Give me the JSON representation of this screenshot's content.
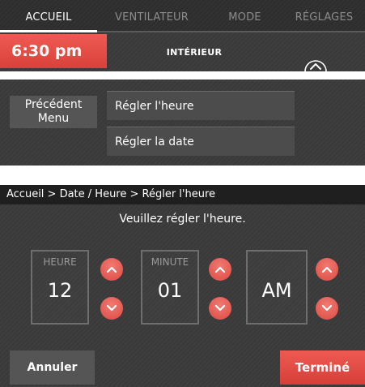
{
  "nav": {
    "tabs": [
      {
        "label": "ACCUEIL",
        "active": true
      },
      {
        "label": "VENTILATEUR",
        "active": false
      },
      {
        "label": "MODE",
        "active": false
      },
      {
        "label": "RÉGLAGES",
        "active": false
      }
    ]
  },
  "status": {
    "time": "6:30 pm",
    "location": "INTÉRIEUR",
    "expand_icon": "chevron-up-circle-icon"
  },
  "menu": {
    "back_label": "Précédent Menu",
    "back_line1": "Précédent",
    "back_line2": "Menu",
    "items": [
      {
        "label": "Régler l'heure"
      },
      {
        "label": "Régler la date"
      }
    ]
  },
  "time_screen": {
    "breadcrumb": "Accueil > Date / Heure > Régler l'heure",
    "prompt": "Veuillez régler l'heure.",
    "hour": {
      "label": "HEURE",
      "value": "12"
    },
    "minute": {
      "label": "MINUTE",
      "value": "01"
    },
    "period": {
      "value": "AM"
    },
    "cancel_label": "Annuler",
    "done_label": "Terminé"
  },
  "colors": {
    "accent_red": "#e24a43",
    "background_dark": "#3a3a3a"
  }
}
